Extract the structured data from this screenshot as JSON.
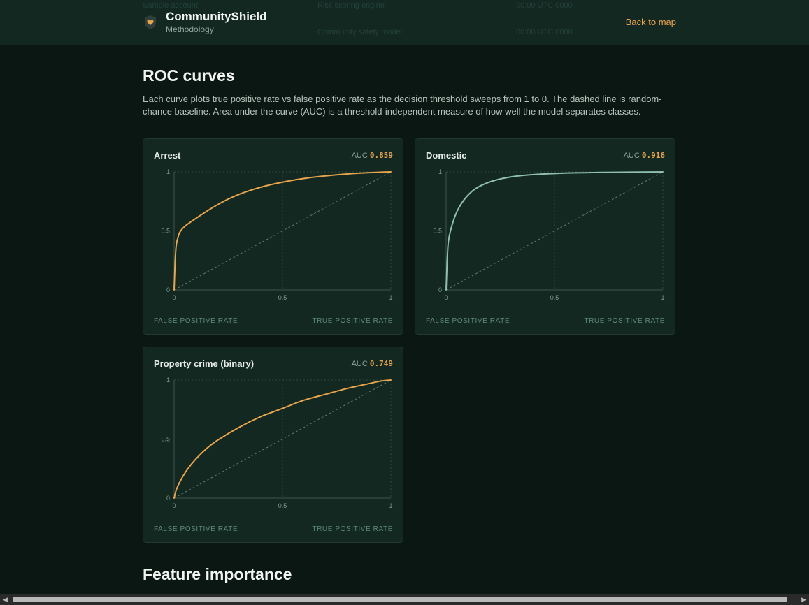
{
  "header": {
    "brand_title": "CommunityShield",
    "brand_subtitle": "Methodology",
    "back_link": "Back to map"
  },
  "section_roc": {
    "title": "ROC curves",
    "description": "Each curve plots true positive rate vs false positive rate as the decision threshold sweeps from 1 to 0. The dashed line is random-chance baseline. Area under the curve (AUC) is a threshold-independent measure of how well the model separates classes.",
    "auc_label": "AUC",
    "x_axis_label": "FALSE POSITIVE RATE",
    "y_axis_label": "TRUE POSITIVE RATE"
  },
  "section_feature": {
    "title": "Feature importance"
  },
  "colors": {
    "accent": "#e8a54c",
    "teal": "#8fbfae",
    "grid": "#2f4a3f"
  },
  "chart_data": [
    {
      "type": "line",
      "title": "Arrest",
      "auc": "0.859",
      "color": "#e8a54c",
      "xlim": [
        0,
        1
      ],
      "ylim": [
        0,
        1
      ],
      "xticks": [
        0,
        0.5,
        1
      ],
      "yticks": [
        0,
        0.5,
        1
      ],
      "tick_labels": [
        "0",
        "0.5",
        "1"
      ],
      "grid": true,
      "baseline": "diagonal",
      "series": [
        {
          "x": [
            0,
            0.005,
            0.01,
            0.02,
            0.03,
            0.05,
            0.08,
            0.12,
            0.18,
            0.25,
            0.33,
            0.42,
            0.52,
            0.62,
            0.72,
            0.82,
            0.9,
            0.95,
            1
          ],
          "y": [
            0,
            0.25,
            0.38,
            0.46,
            0.5,
            0.54,
            0.58,
            0.63,
            0.7,
            0.77,
            0.83,
            0.88,
            0.92,
            0.95,
            0.97,
            0.985,
            0.993,
            0.997,
            1
          ]
        }
      ]
    },
    {
      "type": "line",
      "title": "Domestic",
      "auc": "0.916",
      "color": "#8fbfae",
      "xlim": [
        0,
        1
      ],
      "ylim": [
        0,
        1
      ],
      "xticks": [
        0,
        0.5,
        1
      ],
      "yticks": [
        0,
        0.5,
        1
      ],
      "tick_labels": [
        "0",
        "0.5",
        "1"
      ],
      "grid": true,
      "baseline": "diagonal",
      "series": [
        {
          "x": [
            0,
            0.005,
            0.01,
            0.02,
            0.04,
            0.06,
            0.09,
            0.13,
            0.18,
            0.25,
            0.33,
            0.43,
            0.55,
            0.7,
            0.85,
            1
          ],
          "y": [
            0,
            0.25,
            0.4,
            0.5,
            0.62,
            0.7,
            0.78,
            0.85,
            0.9,
            0.94,
            0.965,
            0.98,
            0.99,
            0.995,
            0.998,
            1
          ]
        }
      ]
    },
    {
      "type": "line",
      "title": "Property crime (binary)",
      "auc": "0.749",
      "color": "#e8a54c",
      "xlim": [
        0,
        1
      ],
      "ylim": [
        0,
        1
      ],
      "xticks": [
        0,
        0.5,
        1
      ],
      "yticks": [
        0,
        0.5,
        1
      ],
      "tick_labels": [
        "0",
        "0.5",
        "1"
      ],
      "grid": true,
      "baseline": "diagonal",
      "series": [
        {
          "x": [
            0,
            0.01,
            0.03,
            0.06,
            0.1,
            0.15,
            0.2,
            0.3,
            0.4,
            0.5,
            0.6,
            0.7,
            0.8,
            0.9,
            0.95,
            1
          ],
          "y": [
            0,
            0.07,
            0.15,
            0.24,
            0.33,
            0.42,
            0.49,
            0.6,
            0.69,
            0.76,
            0.83,
            0.88,
            0.93,
            0.97,
            0.99,
            1
          ]
        }
      ]
    }
  ]
}
